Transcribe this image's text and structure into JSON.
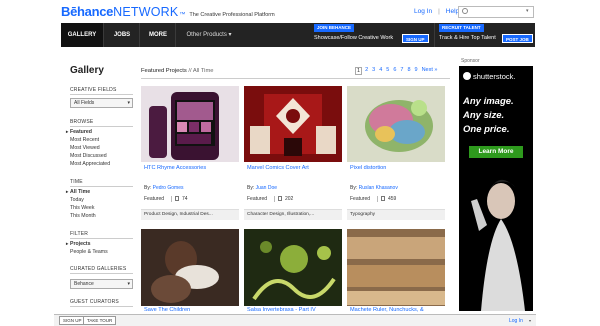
{
  "header": {
    "logo_be": "Bēhance",
    "logo_network": "NETWORK",
    "logo_tm": "™",
    "tagline": "The Creative Professional Platform",
    "login": "Log In",
    "help": "Help",
    "separator": "|",
    "search_placeholder": ""
  },
  "nav": {
    "gallery": "GALLERY",
    "jobs": "JOBS",
    "more": "MORE",
    "other_products": "Other Products ▾",
    "join_badge": "JOIN BEHANCE",
    "join_text": "Showcase/Follow Creative Work",
    "signup_btn": "SIGN UP",
    "recruit_badge": "RECRUIT TALENT",
    "recruit_text": "Track & Hire Top Talent",
    "post_job_btn": "POST JOB"
  },
  "sidebar": {
    "title": "Gallery",
    "creative_fields_label": "CREATIVE FIELDS",
    "creative_fields_value": "All Fields",
    "browse_label": "BROWSE",
    "browse_items": [
      "Featured",
      "Most Recent",
      "Most Viewed",
      "Most Discussed",
      "Most Appreciated"
    ],
    "time_label": "TIME",
    "time_items": [
      "All Time",
      "Today",
      "This Week",
      "This Month"
    ],
    "filter_label": "FILTER",
    "filter_items": [
      "Projects",
      "People & Teams"
    ],
    "curated_label": "CURATED GALLERIES",
    "curated_value": "Behance",
    "guest_label": "GUEST CURATORS"
  },
  "main": {
    "featured": "Featured Projects",
    "all_time": "// All Time",
    "pages": [
      "1",
      "2",
      "3",
      "4",
      "5",
      "6",
      "7",
      "8",
      "9"
    ],
    "next": "Next »"
  },
  "cards": [
    {
      "title": "HTC Rhyme Accessories",
      "by": "By:",
      "author": "Pedro Gomes",
      "featured": "Featured",
      "count": "74",
      "fields": "Product Design, Industrial Des..."
    },
    {
      "title": "Marvel Comics Cover Art",
      "by": "By:",
      "author": "Juan Doe",
      "featured": "Featured",
      "count": "202",
      "fields": "Character Design, Illustration,..."
    },
    {
      "title": "Pixel distortion",
      "by": "By:",
      "author": "Ruslan Khasanov",
      "featured": "Featured",
      "count": "459",
      "fields": "Typography"
    },
    {
      "title": "Save The Children"
    },
    {
      "title": "Salsa Invertebraxa - Part IV"
    },
    {
      "title": "Machete Ruler, Nunchucks, &"
    }
  ],
  "sponsor": {
    "label": "Sponsor",
    "brand": "shutterstock.",
    "line1": "Any image.",
    "line2": "Any size.",
    "line3": "One price.",
    "cta": "Learn More"
  },
  "bottombar": {
    "signup": "SIGN UP",
    "tour": "TAKE TOUR",
    "login": "Log In",
    "caret": "▾"
  },
  "colors": {
    "accent": "#1769ff",
    "nav_bg": "#232323",
    "ad_green": "#2e9a1d"
  }
}
